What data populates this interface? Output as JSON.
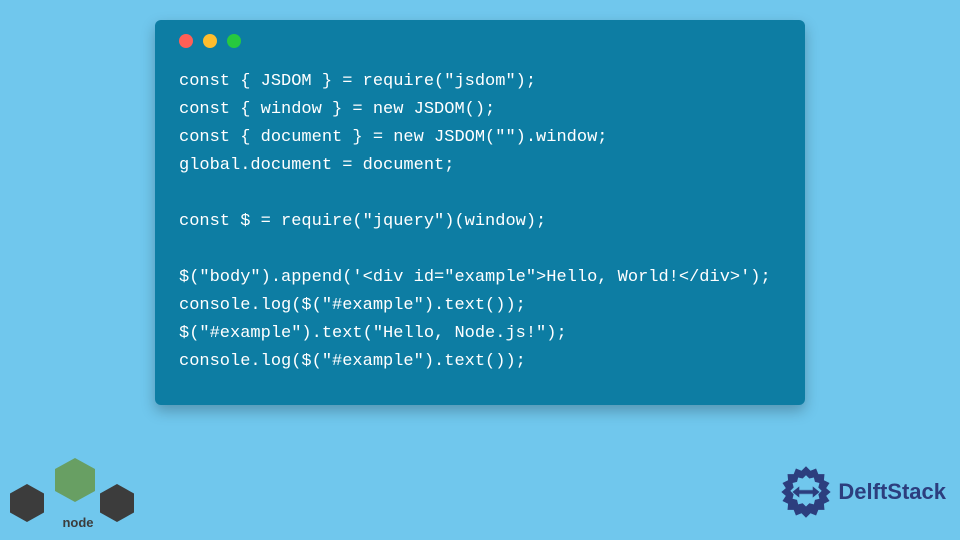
{
  "code": {
    "lines": [
      "const { JSDOM } = require(\"jsdom\");",
      "const { window } = new JSDOM();",
      "const { document } = new JSDOM(\"\").window;",
      "global.document = document;",
      "",
      "const $ = require(\"jquery\")(window);",
      "",
      "$(\"body\").append('<div id=\"example\">Hello, World!</div>');",
      "console.log($(\"#example\").text());",
      "$(\"#example\").text(\"Hello, Node.js!\");",
      "console.log($(\"#example\").text());"
    ]
  },
  "logos": {
    "node": "node",
    "delft": "DelftStack"
  },
  "colors": {
    "background": "#70c7ed",
    "window": "#0d7da3",
    "codeText": "#ffffff",
    "delftBrand": "#2c3e7e",
    "nodeGreen": "#689f63"
  }
}
